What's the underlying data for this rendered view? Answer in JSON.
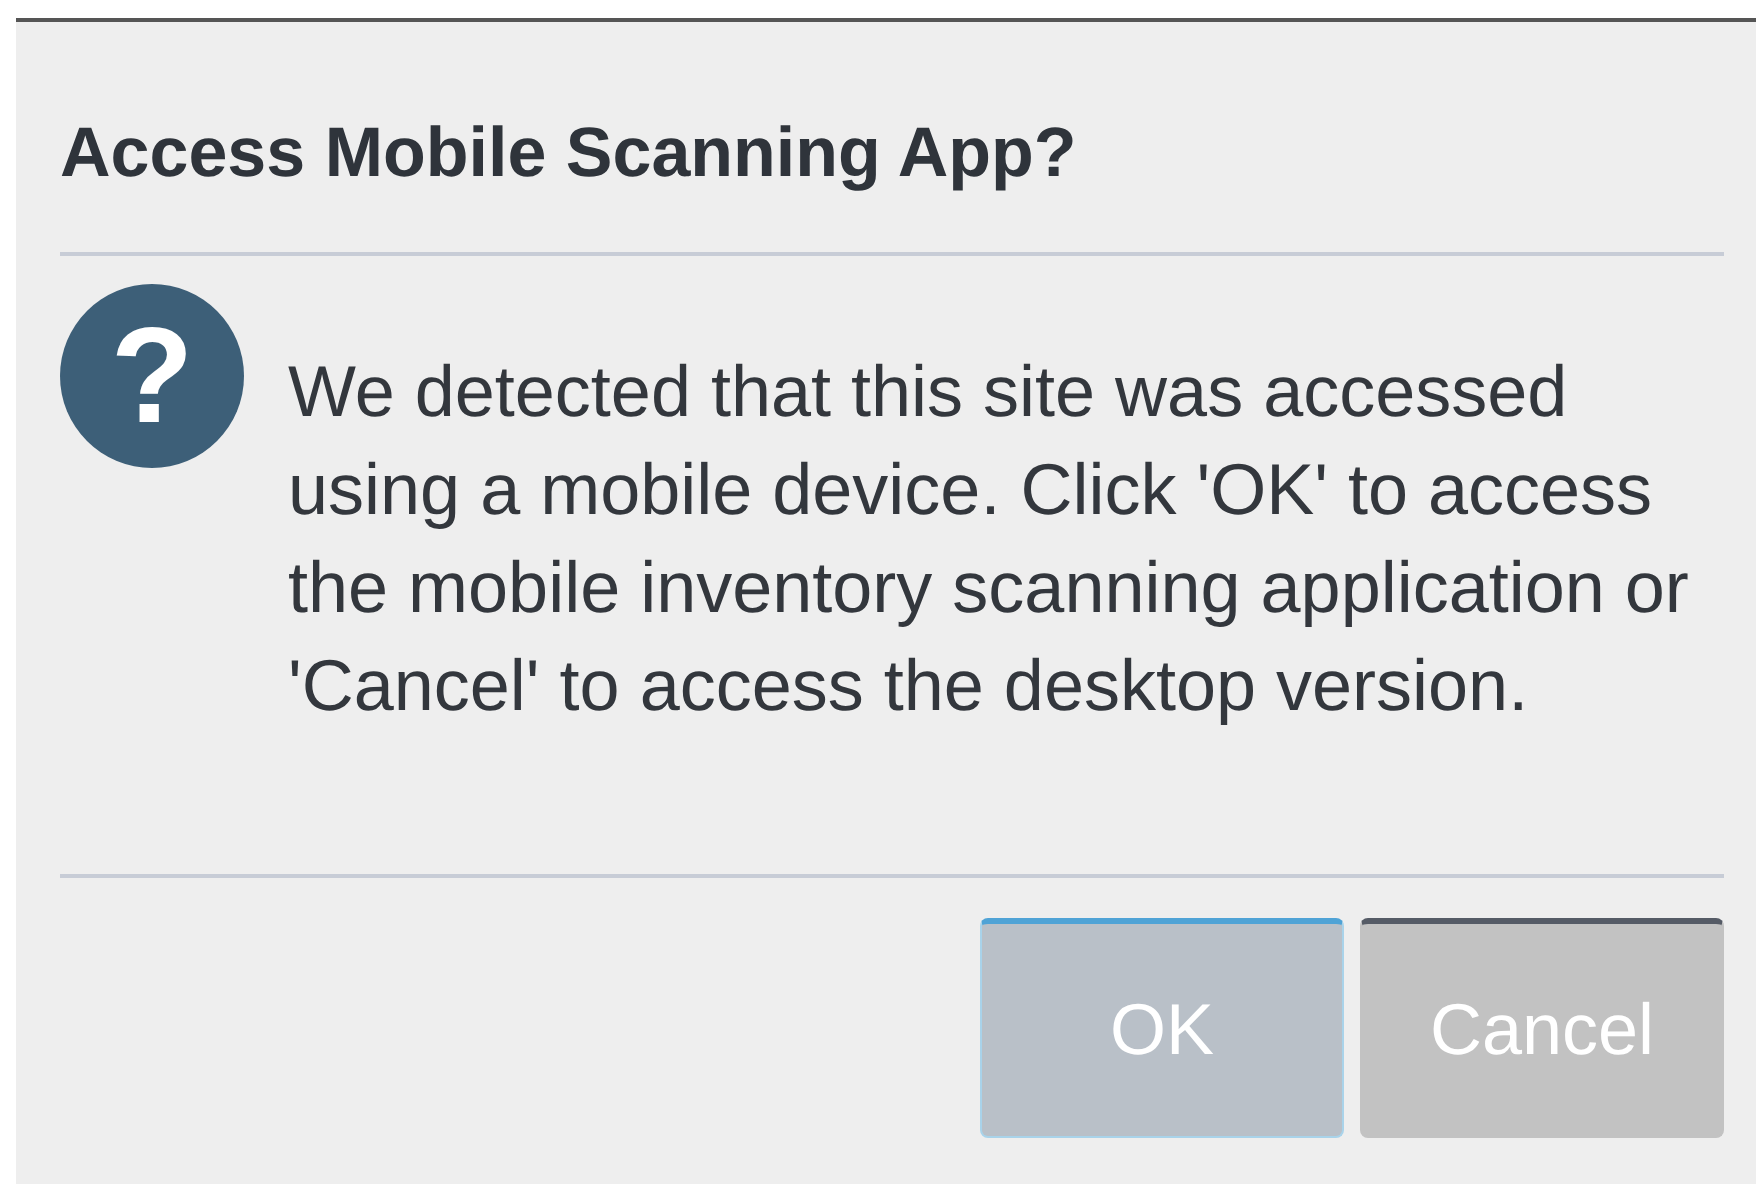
{
  "dialog": {
    "title": "Access Mobile Scanning App?",
    "icon": "?",
    "message": "We detected that this site was accessed using a mobile device. Click 'OK' to access the mobile inventory scanning application or 'Cancel' to access the desktop version.",
    "buttons": [
      {
        "label": "OK",
        "focused": true,
        "disabled": true
      },
      {
        "label": "Cancel",
        "focused": false,
        "disabled": true
      }
    ]
  }
}
